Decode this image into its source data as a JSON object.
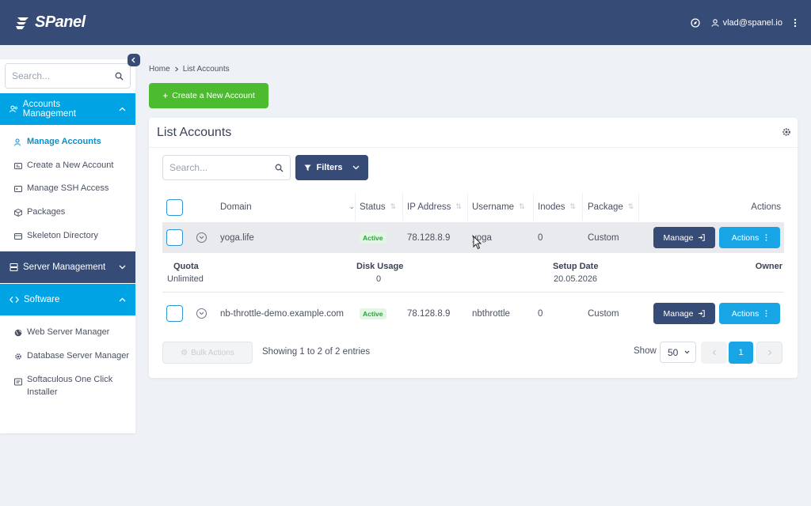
{
  "app": {
    "logo_text": "SPanel"
  },
  "topbar": {
    "user_email": "vlad@spanel.io"
  },
  "sidebar": {
    "search_placeholder": "Search...",
    "accounts_section": {
      "label": "Accounts Management",
      "items": [
        {
          "label": "Manage Accounts"
        },
        {
          "label": "Create a New Account"
        },
        {
          "label": "Manage SSH Access"
        },
        {
          "label": "Packages"
        },
        {
          "label": "Skeleton Directory"
        }
      ]
    },
    "server_section": {
      "label": "Server Management"
    },
    "software_section": {
      "label": "Software",
      "items": [
        {
          "label": "Web Server Manager"
        },
        {
          "label": "Database Server Manager"
        },
        {
          "label": "Softaculous One Click",
          "label2": "Installer"
        }
      ]
    }
  },
  "breadcrumb": {
    "home": "Home",
    "current": "List Accounts"
  },
  "create_button": "Create a New Account",
  "card": {
    "title": "List Accounts",
    "search_placeholder": "Search...",
    "filters_label": "Filters",
    "columns": {
      "domain": "Domain",
      "status": "Status",
      "ip": "IP Address",
      "username": "Username",
      "inodes": "Inodes",
      "package": "Package",
      "actions": "Actions"
    },
    "rows": [
      {
        "domain": "yoga.life",
        "status": "Active",
        "ip": "78.128.8.9",
        "username": "yoga",
        "inodes": "0",
        "package": "Custom"
      },
      {
        "domain": "nb-throttle-demo.example.com",
        "status": "Active",
        "ip": "78.128.8.9",
        "username": "nbthrottle",
        "inodes": "0",
        "package": "Custom"
      }
    ],
    "detail": {
      "quota_label": "Quota",
      "quota_value": "Unlimited",
      "disk_label": "Disk Usage",
      "disk_value": "0",
      "setup_label": "Setup Date",
      "setup_value": "20.05.2026",
      "owner_label": "Owner",
      "owner_value": ""
    },
    "manage_label": "Manage",
    "actions_label": "Actions",
    "bulk_label": "Bulk Actions",
    "showing_text": "Showing 1 to 2 of 2 entries",
    "show_label": "Show",
    "page_size": "50",
    "current_page": "1"
  },
  "colors": {
    "topbar": "#364b76",
    "accent_blue": "#00a4e4",
    "create_green": "#4cbb2f",
    "active_badge": "#2aa33c"
  }
}
